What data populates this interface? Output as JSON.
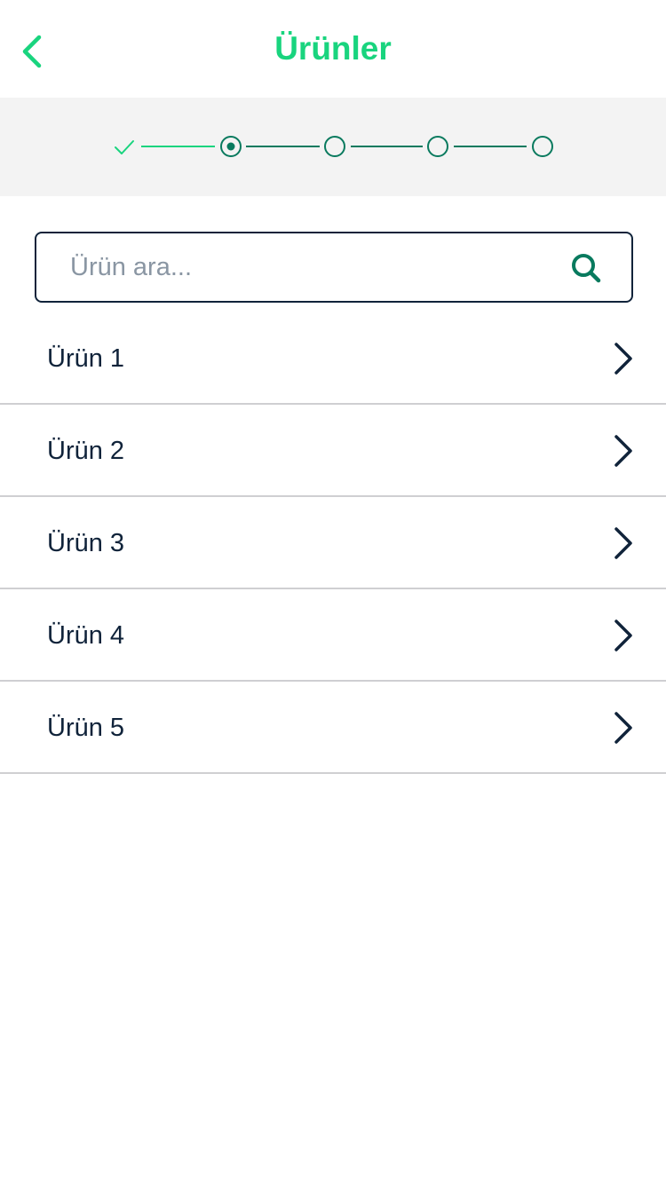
{
  "header": {
    "title": "Ürünler",
    "back_icon": "chevron-left-icon"
  },
  "stepper": {
    "total_steps": 5,
    "completed_steps": 1,
    "current_step": 2,
    "accent_color": "#19d47e",
    "step_color": "#087a5e"
  },
  "search": {
    "placeholder": "Ürün ara...",
    "value": "",
    "icon": "search-icon"
  },
  "products": [
    {
      "label": "Ürün 1"
    },
    {
      "label": "Ürün 2"
    },
    {
      "label": "Ürün 3"
    },
    {
      "label": "Ürün 4"
    },
    {
      "label": "Ürün 5"
    }
  ],
  "colors": {
    "brand": "#19d47e",
    "text": "#10233a",
    "divider": "#cfcfd2",
    "band": "#f3f3f3"
  }
}
